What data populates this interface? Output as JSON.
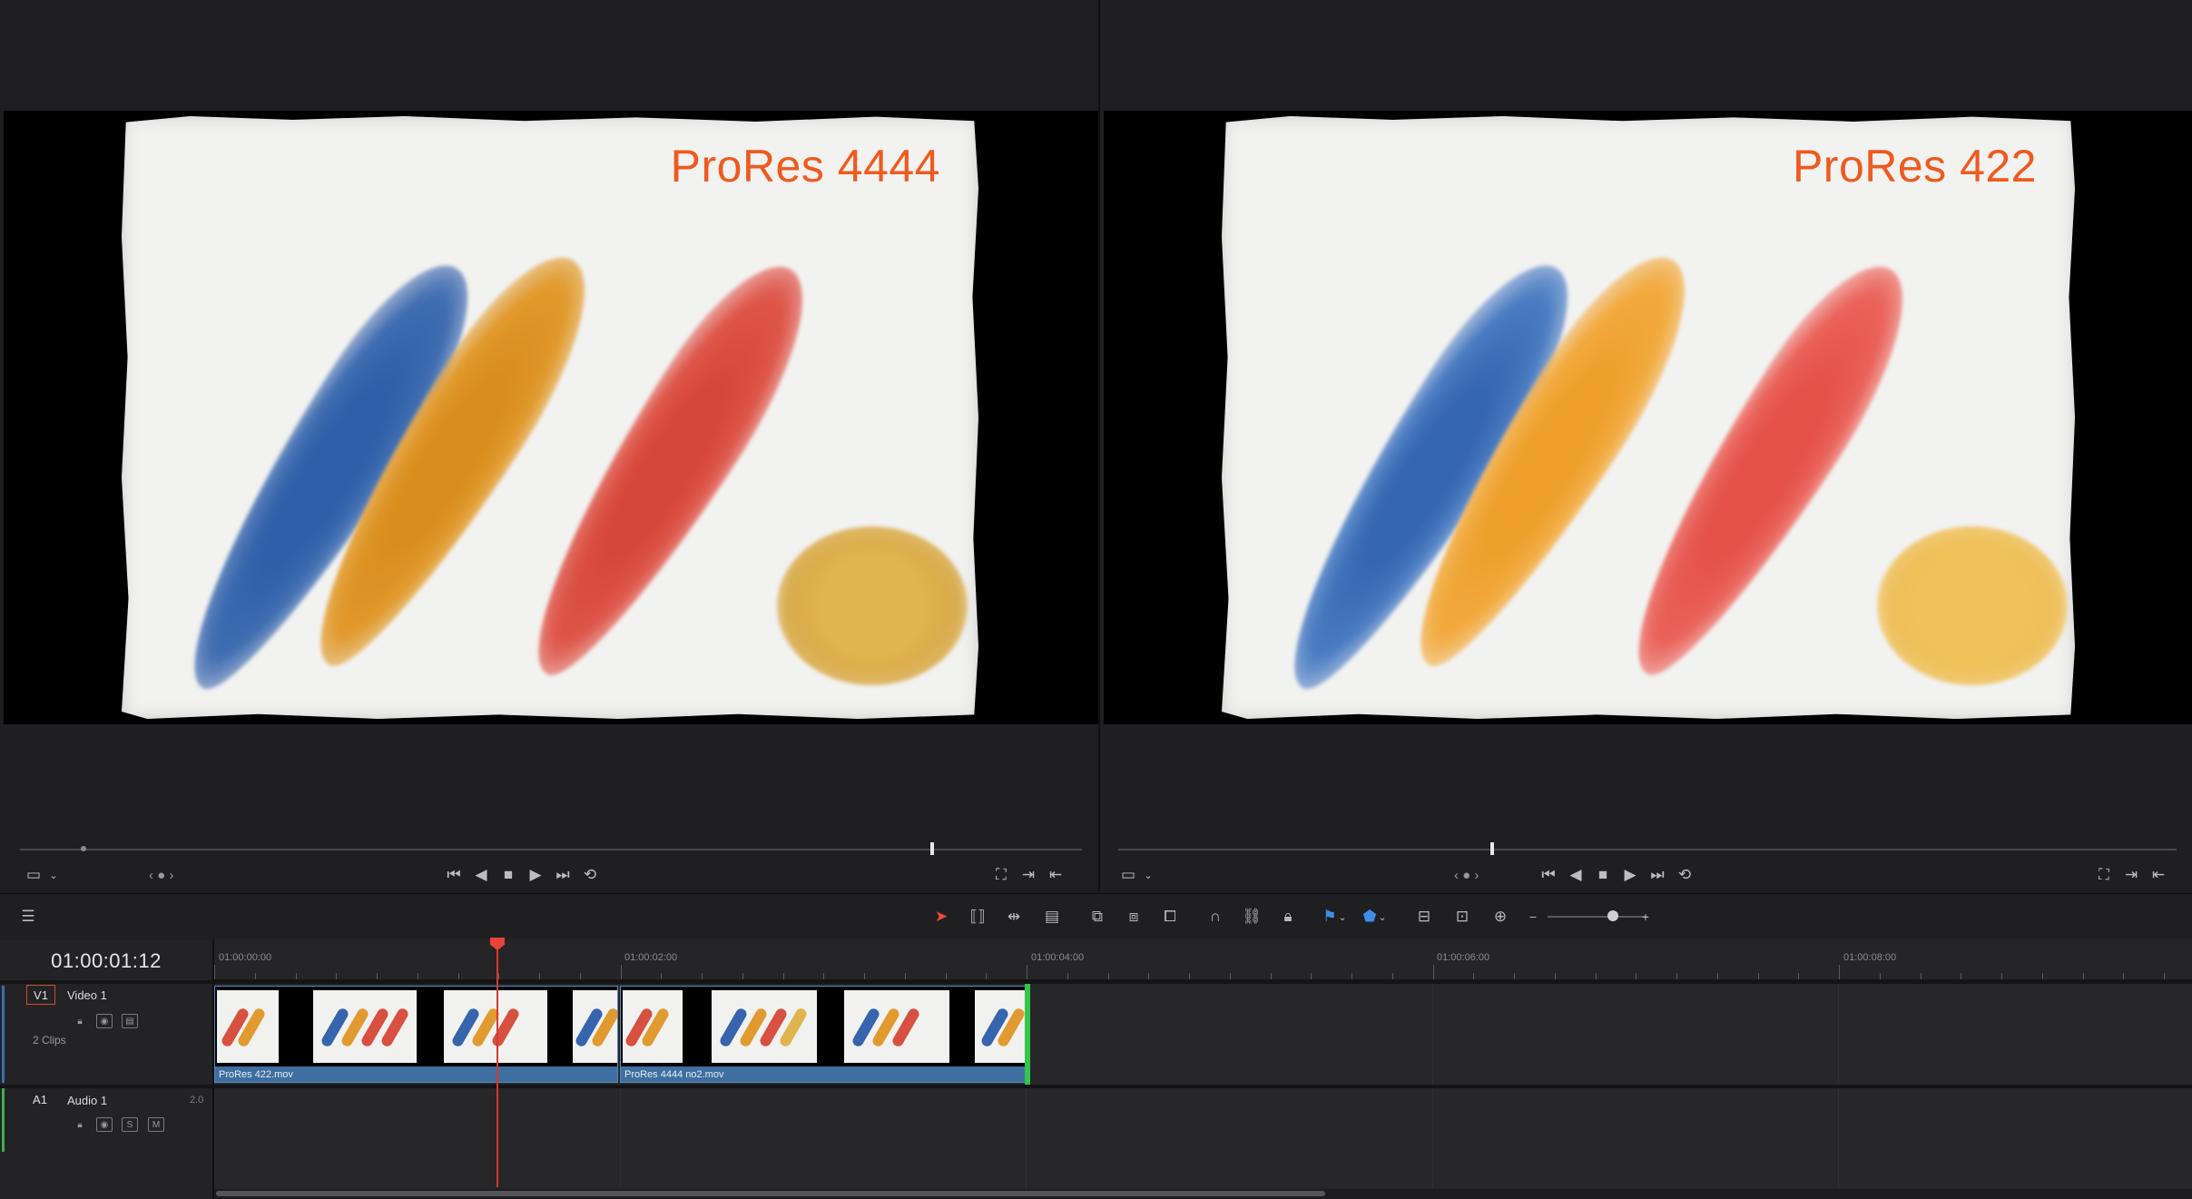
{
  "viewers": [
    {
      "id": "left",
      "codec_label": "ProRes 4444",
      "jog": "‹ ● ›"
    },
    {
      "id": "right",
      "codec_label": "ProRes 422",
      "jog": "‹ ● ›"
    }
  ],
  "colors": {
    "accent_orange": "#ee5a1f",
    "playhead": "#e8443a",
    "clip_blue": "#3f6ea0",
    "clip_end_green": "#34c54a"
  },
  "timeline": {
    "timecode": "01:00:01:12",
    "ruler": [
      "01:00:00:00",
      "01:00:02:00",
      "01:00:04:00",
      "01:00:06:00",
      "01:00:08:00"
    ],
    "tracks": {
      "video": {
        "tag": "V1",
        "name": "Video 1",
        "clip_count": "2 Clips"
      },
      "audio": {
        "tag": "A1",
        "name": "Audio 1",
        "channels": "2.0",
        "solo": "S",
        "mute": "M"
      }
    },
    "clips": [
      {
        "name": "ProRes 422.mov"
      },
      {
        "name": "ProRes 4444 no2.mov"
      }
    ]
  }
}
